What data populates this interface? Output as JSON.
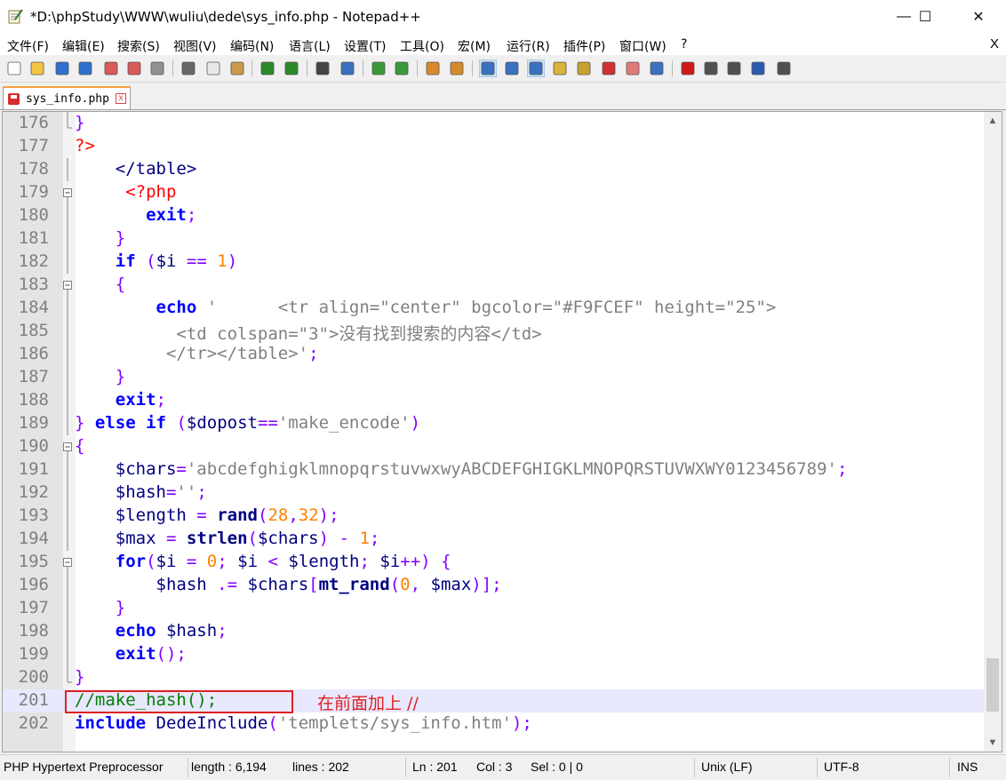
{
  "window": {
    "title": "*D:\\phpStudy\\WWW\\wuliu\\dede\\sys_info.php - Notepad++",
    "minimize": "—",
    "maximize": "☐",
    "close": "✕"
  },
  "menu": {
    "items": [
      "文件(F)",
      "编辑(E)",
      "搜索(S)",
      "视图(V)",
      "编码(N)",
      "语言(L)",
      "设置(T)",
      "工具(O)",
      "宏(M)",
      "运行(R)",
      "插件(P)",
      "窗口(W)",
      "?"
    ],
    "close": "X"
  },
  "toolbar": {
    "icons": [
      "new-file-icon",
      "open-file-icon",
      "save-icon",
      "save-all-icon",
      "close-icon",
      "close-all-icon",
      "print-icon",
      "cut-icon",
      "copy-icon",
      "paste-icon",
      "undo-icon",
      "redo-icon",
      "find-icon",
      "replace-icon",
      "zoom-in-icon",
      "zoom-out-icon",
      "sync-vertical-icon",
      "sync-horizontal-icon",
      "word-wrap-icon",
      "show-all-chars-icon",
      "indent-guide-icon",
      "user-language-icon",
      "doc-map-icon",
      "function-list-icon",
      "folder-workspace-icon",
      "monitoring-icon",
      "record-macro-icon",
      "stop-macro-icon",
      "play-macro-icon",
      "run-macro-multiple-icon",
      "save-macro-icon"
    ]
  },
  "tab": {
    "label": "sys_info.php",
    "close": "x"
  },
  "editor": {
    "lines": [
      {
        "n": "176",
        "segs": [
          [
            "op",
            "}"
          ]
        ]
      },
      {
        "n": "177",
        "segs": [
          [
            "phpt",
            "?>"
          ]
        ]
      },
      {
        "n": "178",
        "segs": [
          [
            "plain",
            "    "
          ],
          [
            "html",
            "</table>"
          ]
        ]
      },
      {
        "n": "179",
        "segs": [
          [
            "plain",
            "     "
          ],
          [
            "phpt",
            "<?php"
          ]
        ]
      },
      {
        "n": "180",
        "segs": [
          [
            "plain",
            "       "
          ],
          [
            "kw",
            "exit"
          ],
          [
            "op",
            ";"
          ]
        ]
      },
      {
        "n": "181",
        "segs": [
          [
            "plain",
            "    "
          ],
          [
            "op",
            "}"
          ]
        ]
      },
      {
        "n": "182",
        "segs": [
          [
            "plain",
            "    "
          ],
          [
            "kw",
            "if"
          ],
          [
            "plain",
            " "
          ],
          [
            "op",
            "("
          ],
          [
            "var",
            "$i"
          ],
          [
            "plain",
            " "
          ],
          [
            "op",
            "=="
          ],
          [
            "plain",
            " "
          ],
          [
            "num",
            "1"
          ],
          [
            "op",
            ")"
          ]
        ]
      },
      {
        "n": "183",
        "segs": [
          [
            "plain",
            "    "
          ],
          [
            "op",
            "{"
          ]
        ]
      },
      {
        "n": "184",
        "segs": [
          [
            "plain",
            "        "
          ],
          [
            "kw",
            "echo"
          ],
          [
            "plain",
            " "
          ],
          [
            "str",
            "'      <tr align=\"center\" bgcolor=\"#F9FCEF\" height=\"25\">"
          ]
        ]
      },
      {
        "n": "185",
        "segs": [
          [
            "str",
            "          <td colspan=\"3\">没有找到搜索的内容</td>"
          ]
        ]
      },
      {
        "n": "186",
        "segs": [
          [
            "str",
            "         </tr></table>'"
          ],
          [
            "op",
            ";"
          ]
        ]
      },
      {
        "n": "187",
        "segs": [
          [
            "plain",
            "    "
          ],
          [
            "op",
            "}"
          ]
        ]
      },
      {
        "n": "188",
        "segs": [
          [
            "plain",
            "    "
          ],
          [
            "kw",
            "exit"
          ],
          [
            "op",
            ";"
          ]
        ]
      },
      {
        "n": "189",
        "segs": [
          [
            "op",
            "}"
          ],
          [
            "plain",
            " "
          ],
          [
            "kw",
            "else if"
          ],
          [
            "plain",
            " "
          ],
          [
            "op",
            "("
          ],
          [
            "var",
            "$dopost"
          ],
          [
            "op",
            "=="
          ],
          [
            "str",
            "'make_encode'"
          ],
          [
            "op",
            ")"
          ]
        ]
      },
      {
        "n": "190",
        "segs": [
          [
            "op",
            "{"
          ]
        ]
      },
      {
        "n": "191",
        "segs": [
          [
            "plain",
            "    "
          ],
          [
            "var",
            "$chars"
          ],
          [
            "op",
            "="
          ],
          [
            "str",
            "'abcdefghigklmnopqrstuvwxwyABCDEFGHIGKLMNOPQRSTUVWXWY0123456789'"
          ],
          [
            "op",
            ";"
          ]
        ]
      },
      {
        "n": "192",
        "segs": [
          [
            "plain",
            "    "
          ],
          [
            "var",
            "$hash"
          ],
          [
            "op",
            "="
          ],
          [
            "str",
            "''"
          ],
          [
            "op",
            ";"
          ]
        ]
      },
      {
        "n": "193",
        "segs": [
          [
            "plain",
            "    "
          ],
          [
            "var",
            "$length"
          ],
          [
            "plain",
            " "
          ],
          [
            "op",
            "="
          ],
          [
            "plain",
            " "
          ],
          [
            "fn",
            "rand"
          ],
          [
            "op",
            "("
          ],
          [
            "num",
            "28"
          ],
          [
            "op",
            ","
          ],
          [
            "num",
            "32"
          ],
          [
            "op",
            ");"
          ]
        ]
      },
      {
        "n": "194",
        "segs": [
          [
            "plain",
            "    "
          ],
          [
            "var",
            "$max"
          ],
          [
            "plain",
            " "
          ],
          [
            "op",
            "="
          ],
          [
            "plain",
            " "
          ],
          [
            "fn",
            "strlen"
          ],
          [
            "op",
            "("
          ],
          [
            "var",
            "$chars"
          ],
          [
            "op",
            ")"
          ],
          [
            "plain",
            " "
          ],
          [
            "op",
            "-"
          ],
          [
            "plain",
            " "
          ],
          [
            "num",
            "1"
          ],
          [
            "op",
            ";"
          ]
        ]
      },
      {
        "n": "195",
        "segs": [
          [
            "plain",
            "    "
          ],
          [
            "kw",
            "for"
          ],
          [
            "op",
            "("
          ],
          [
            "var",
            "$i"
          ],
          [
            "plain",
            " "
          ],
          [
            "op",
            "="
          ],
          [
            "plain",
            " "
          ],
          [
            "num",
            "0"
          ],
          [
            "op",
            ";"
          ],
          [
            "plain",
            " "
          ],
          [
            "var",
            "$i"
          ],
          [
            "plain",
            " "
          ],
          [
            "op",
            "<"
          ],
          [
            "plain",
            " "
          ],
          [
            "var",
            "$length"
          ],
          [
            "op",
            ";"
          ],
          [
            "plain",
            " "
          ],
          [
            "var",
            "$i"
          ],
          [
            "op",
            "++)"
          ],
          [
            "plain",
            " "
          ],
          [
            "op",
            "{"
          ]
        ]
      },
      {
        "n": "196",
        "segs": [
          [
            "plain",
            "        "
          ],
          [
            "var",
            "$hash"
          ],
          [
            "plain",
            " "
          ],
          [
            "op",
            ".="
          ],
          [
            "plain",
            " "
          ],
          [
            "var",
            "$chars"
          ],
          [
            "op",
            "["
          ],
          [
            "fn",
            "mt_rand"
          ],
          [
            "op",
            "("
          ],
          [
            "num",
            "0"
          ],
          [
            "op",
            ","
          ],
          [
            "plain",
            " "
          ],
          [
            "var",
            "$max"
          ],
          [
            "op",
            ")];"
          ]
        ]
      },
      {
        "n": "197",
        "segs": [
          [
            "plain",
            "    "
          ],
          [
            "op",
            "}"
          ]
        ]
      },
      {
        "n": "198",
        "segs": [
          [
            "plain",
            "    "
          ],
          [
            "kw",
            "echo"
          ],
          [
            "plain",
            " "
          ],
          [
            "var",
            "$hash"
          ],
          [
            "op",
            ";"
          ]
        ]
      },
      {
        "n": "199",
        "segs": [
          [
            "plain",
            "    "
          ],
          [
            "kw",
            "exit"
          ],
          [
            "op",
            "();"
          ]
        ]
      },
      {
        "n": "200",
        "segs": [
          [
            "op",
            "}"
          ]
        ]
      },
      {
        "n": "201",
        "segs": [
          [
            "cmt",
            "//make_hash();"
          ]
        ]
      },
      {
        "n": "202",
        "segs": [
          [
            "kw",
            "include"
          ],
          [
            "plain",
            " "
          ],
          [
            "var",
            "DedeInclude"
          ],
          [
            "op",
            "("
          ],
          [
            "str",
            "'templets/sys_info.htm'"
          ],
          [
            "op",
            ");"
          ]
        ]
      }
    ],
    "current_line": "201",
    "annotation": "在前面加上 //"
  },
  "status": {
    "lang": "PHP Hypertext Preprocessor",
    "length": "length : 6,194",
    "lines": "lines : 202",
    "ln": "Ln : 201",
    "col": "Col : 3",
    "sel": "Sel : 0 | 0",
    "eol": "Unix (LF)",
    "enc": "UTF-8",
    "mode": "INS"
  },
  "colors": {
    "keyword": "#0000ff",
    "operator": "#8000ff",
    "string": "#808080",
    "number": "#ff8000",
    "comment": "#008000",
    "php_tag": "#ff0000",
    "annotation": "#e02020"
  }
}
